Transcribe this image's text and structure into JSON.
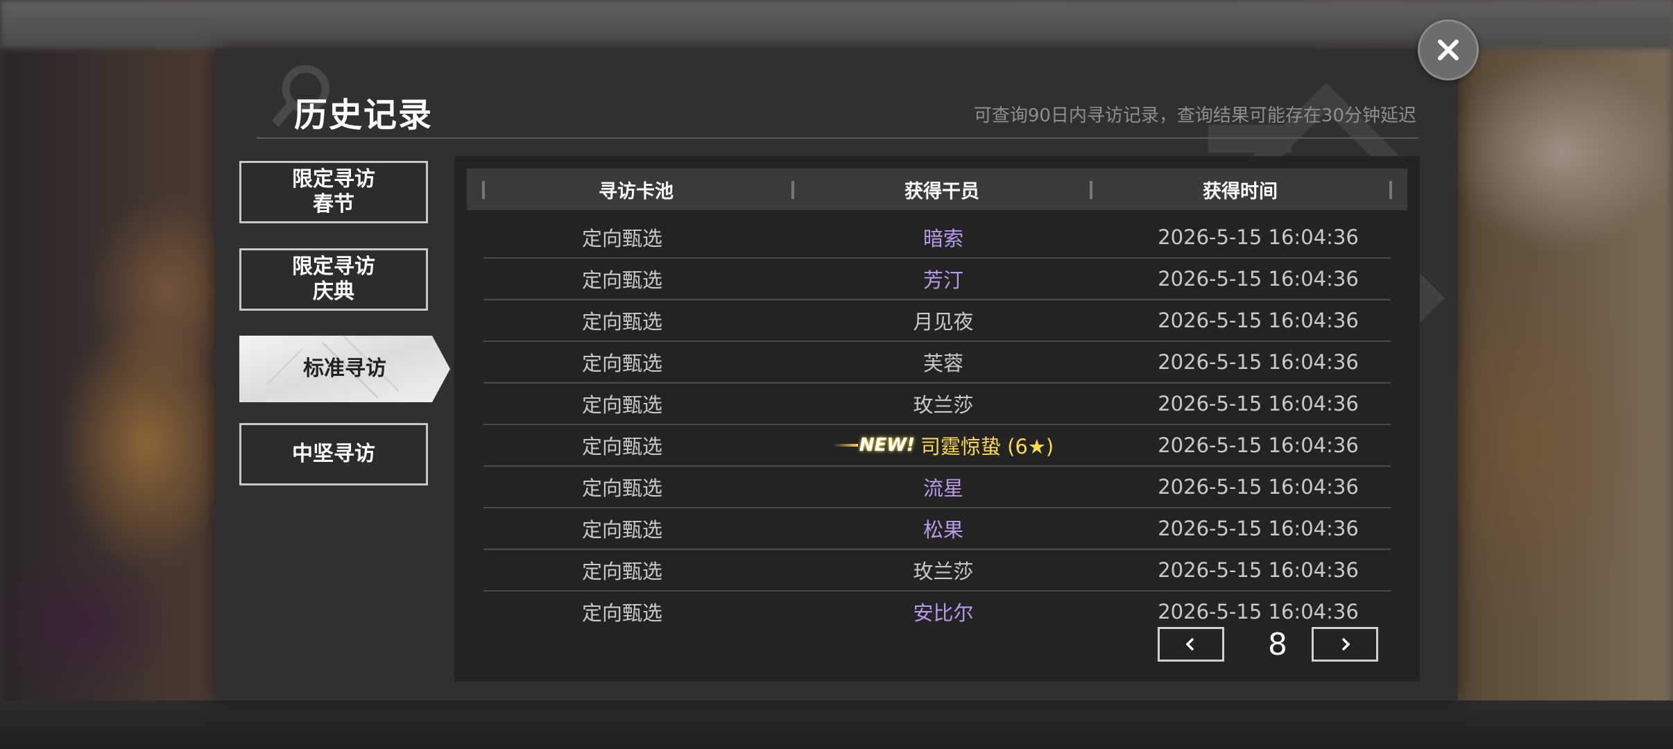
{
  "dialog": {
    "title": "历史记录",
    "subtitle": "可查询90日内寻访记录，查询结果可能存在30分钟延迟"
  },
  "tabs": [
    {
      "label": "限定寻访\n春节",
      "active": false
    },
    {
      "label": "限定寻访\n庆典",
      "active": false
    },
    {
      "label": "标准寻访",
      "active": true
    },
    {
      "label": "中坚寻访",
      "active": false
    }
  ],
  "table": {
    "headers": [
      "寻访卡池",
      "获得干员",
      "获得时间"
    ],
    "rows": [
      {
        "pool": "定向甄选",
        "operator": "暗索",
        "time": "2026-5-15 16:04:36",
        "color": "#b89be8"
      },
      {
        "pool": "定向甄选",
        "operator": "芳汀",
        "time": "2026-5-15 16:04:36",
        "color": "#b89be8"
      },
      {
        "pool": "定向甄选",
        "operator": "月见夜",
        "time": "2026-5-15 16:04:36",
        "color": "#c9c9c9"
      },
      {
        "pool": "定向甄选",
        "operator": "芙蓉",
        "time": "2026-5-15 16:04:36",
        "color": "#c9c9c9"
      },
      {
        "pool": "定向甄选",
        "operator": "玫兰莎",
        "time": "2026-5-15 16:04:36",
        "color": "#c9c9c9"
      },
      {
        "pool": "定向甄选",
        "operator": "司霆惊蛰 (6★)",
        "new_badge": "NEW!",
        "time": "2026-5-15 16:04:36",
        "color": "#ffd84a"
      },
      {
        "pool": "定向甄选",
        "operator": "流星",
        "time": "2026-5-15 16:04:36",
        "color": "#b89be8"
      },
      {
        "pool": "定向甄选",
        "operator": "松果",
        "time": "2026-5-15 16:04:36",
        "color": "#b89be8"
      },
      {
        "pool": "定向甄选",
        "operator": "玫兰莎",
        "time": "2026-5-15 16:04:36",
        "color": "#c9c9c9"
      },
      {
        "pool": "定向甄选",
        "operator": "安比尔",
        "time": "2026-5-15 16:04:36",
        "color": "#b89be8"
      }
    ]
  },
  "pager": {
    "current_page": "8",
    "prev_icon": "chevron-left-icon",
    "next_icon": "chevron-right-icon"
  },
  "close_icon": "close-icon",
  "colors": {
    "rarity_purple": "#b89be8",
    "rarity_gold": "#ffd84a",
    "dialog_bg": "#303030",
    "panel_bg": "#232323"
  }
}
